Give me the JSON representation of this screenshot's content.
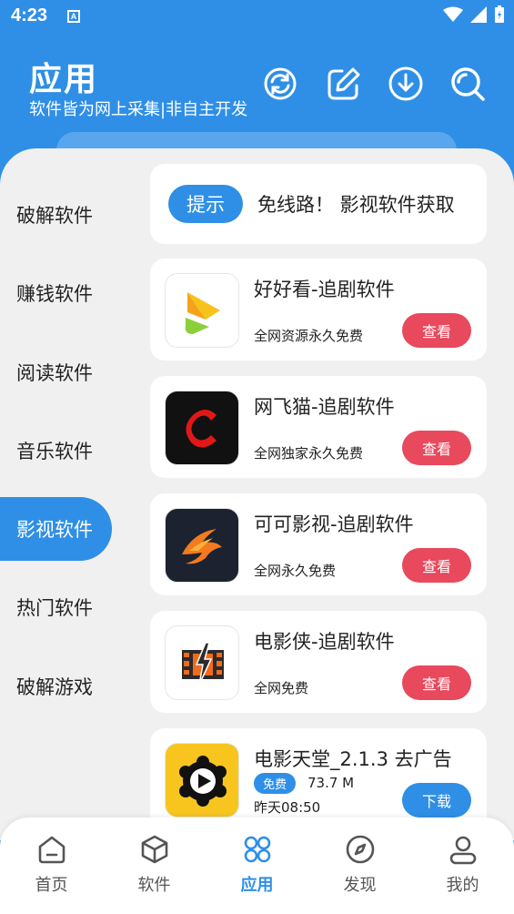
{
  "status": {
    "time": "4:23",
    "badge": "A"
  },
  "header": {
    "title": "应用",
    "subtitle": "软件皆为网上采集|非自主开发",
    "icons": [
      "refresh-icon",
      "edit-icon",
      "download-icon",
      "search-icon"
    ]
  },
  "sidebar": {
    "items": [
      {
        "label": "破解软件",
        "active": false
      },
      {
        "label": "赚钱软件",
        "active": false
      },
      {
        "label": "阅读软件",
        "active": false
      },
      {
        "label": "音乐软件",
        "active": false
      },
      {
        "label": "影视软件",
        "active": true
      },
      {
        "label": "热门软件",
        "active": false
      },
      {
        "label": "破解游戏",
        "active": false
      }
    ]
  },
  "notice": {
    "tag": "提示",
    "text": "免线路！    影视软件获取"
  },
  "apps": [
    {
      "title": "好好看-追剧软件",
      "desc": "全网资源永久免费",
      "button": "查看",
      "icon": "haohaokan-icon"
    },
    {
      "title": "网飞猫-追剧软件",
      "desc": "全网独家永久免费",
      "button": "查看",
      "icon": "wangfeimao-icon"
    },
    {
      "title": "可可影视-追剧软件",
      "desc": "全网永久免费",
      "button": "查看",
      "icon": "keke-icon"
    },
    {
      "title": "电影侠-追剧软件",
      "desc": "全网免费",
      "button": "查看",
      "icon": "dianyingxia-icon"
    }
  ],
  "download_app": {
    "title": "电影天堂_2.1.3 去广告",
    "badge": "免费",
    "size": "73.7 M",
    "date": "昨天08:50",
    "button": "下载",
    "icon": "dianyingtiantang-icon"
  },
  "bottom_nav": {
    "items": [
      {
        "label": "首页",
        "icon": "home-icon",
        "active": false
      },
      {
        "label": "软件",
        "icon": "cube-icon",
        "active": false
      },
      {
        "label": "应用",
        "icon": "apps-icon",
        "active": true
      },
      {
        "label": "发现",
        "icon": "compass-icon",
        "active": false
      },
      {
        "label": "我的",
        "icon": "user-icon",
        "active": false
      }
    ]
  },
  "colors": {
    "primary": "#2f8fe6",
    "danger": "#e8495d",
    "panel": "#f0f0f0"
  }
}
